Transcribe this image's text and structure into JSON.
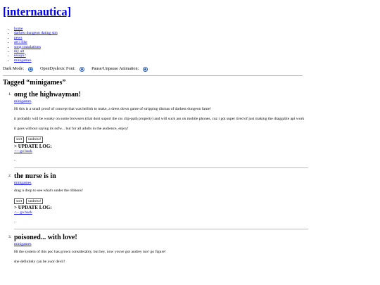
{
  "site": {
    "title": "[internautica]"
  },
  "nav": [
    "home",
    "darkest dungeon dating sim",
    "news",
    "art i like",
    "song translations",
    "my art",
    "essays?",
    "minigames"
  ],
  "toggles": [
    {
      "label": "Dark Mode:"
    },
    {
      "label": "OpenDyslexic Font:"
    },
    {
      "label": "Pause/Unpause Animation:"
    }
  ],
  "page": {
    "heading": "Tagged “minigames”"
  },
  "posts": [
    {
      "number": "1.",
      "title": "omg the highwayman!",
      "tag": "minigames",
      "paragraphs": [
        "Hi this is a small proof of concept that was hellish to make, a dress down game of stripping dismas of darkest dungeon fame!",
        "it probably will be wonky on some browsers (that dont suport the css clip-path property) and will suck ass on mobile phones, cuz i got super tired of just making the draggable api work",
        "it goes without saying its nsfw... but for all adults in the audience, enjoy!"
      ],
      "buttons": [
        "sort",
        "undress!"
      ],
      "update": "> UPDATE LOG:",
      "back": "<-- go back",
      "dash": "-"
    },
    {
      "number": "2.",
      "title": "the nurse is in",
      "tag": "minigames",
      "paragraphs": [
        "drag n drop to see what's under the ribbons!"
      ],
      "buttons": [
        "sort",
        "undress!"
      ],
      "update": "> UPDATE LOG:",
      "back": "<-- go back",
      "dash": "-"
    },
    {
      "number": "3.",
      "title": "poisoned... with love!",
      "tag": "minigames",
      "paragraphs": [
        "Hi the system of this poc has grown considerably, but hey, now youve got audrey too! go figure!",
        "she definitely can be yuor devil!"
      ]
    }
  ]
}
